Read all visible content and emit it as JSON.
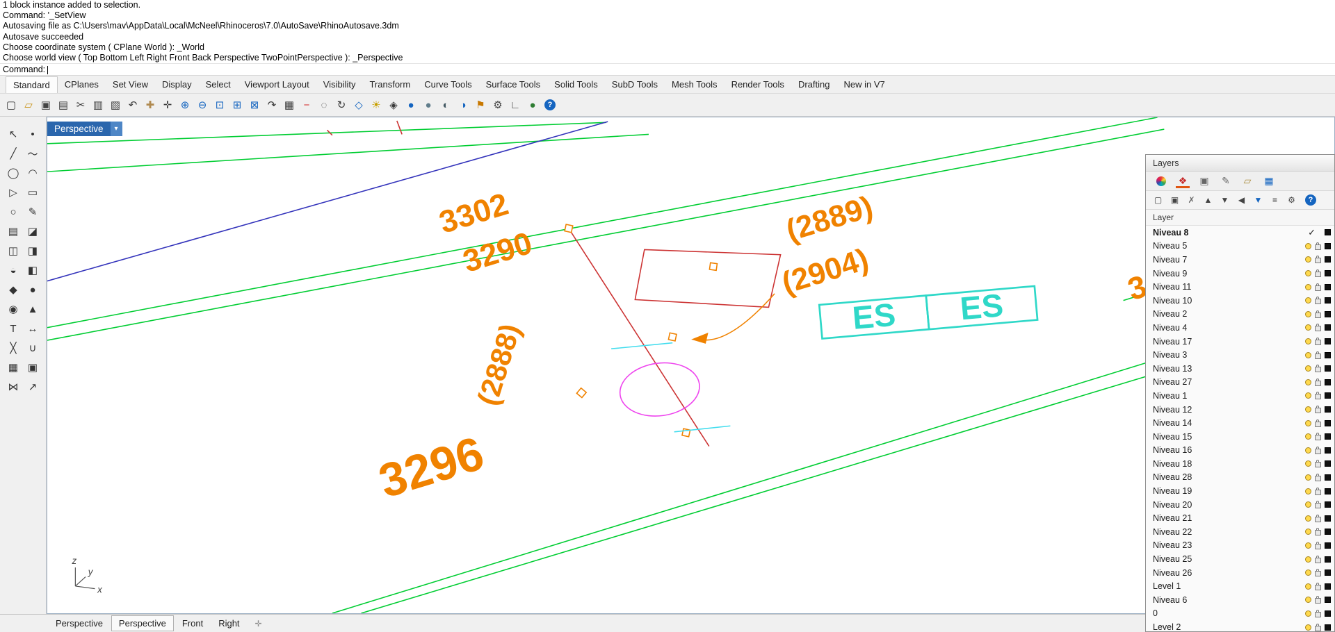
{
  "command_area": {
    "history": [
      "1 block instance added to selection.",
      "Command: '_SetView",
      "Autosaving file as C:\\Users\\mav\\AppData\\Local\\McNeel\\Rhinoceros\\7.0\\AutoSave\\RhinoAutosave.3dm",
      "Autosave succeeded",
      "Choose coordinate system ( CPlane  World ): _World",
      "Choose world view ( Top  Bottom  Left  Right  Front  Back  Perspective  TwoPointPerspective ): _Perspective"
    ],
    "prompt": "Command:"
  },
  "menu_tabs": [
    "Standard",
    "CPlanes",
    "Set View",
    "Display",
    "Select",
    "Viewport Layout",
    "Visibility",
    "Transform",
    "Curve Tools",
    "Surface Tools",
    "Solid Tools",
    "SubD Tools",
    "Mesh Tools",
    "Render Tools",
    "Drafting",
    "New in V7"
  ],
  "toolbar_icons": [
    {
      "n": "new-file-icon",
      "g": "▢"
    },
    {
      "n": "open-file-icon",
      "g": "▱",
      "c": "#c89010"
    },
    {
      "n": "save-icon",
      "g": "▣",
      "c": "#444"
    },
    {
      "n": "print-icon",
      "g": "▤"
    },
    {
      "n": "cut-icon",
      "g": "✂"
    },
    {
      "n": "copy-icon",
      "g": "▥"
    },
    {
      "n": "paste-icon",
      "g": "▧"
    },
    {
      "n": "undo-icon",
      "g": "↶"
    },
    {
      "n": "pan-icon",
      "g": "✚",
      "c": "#b08a50"
    },
    {
      "n": "move-icon",
      "g": "✛"
    },
    {
      "n": "zoom-in-icon",
      "g": "⊕",
      "c": "#1565c0"
    },
    {
      "n": "zoom-out-icon",
      "g": "⊖",
      "c": "#1565c0"
    },
    {
      "n": "zoom-window-icon",
      "g": "⊡",
      "c": "#1565c0"
    },
    {
      "n": "zoom-extents-icon",
      "g": "⊞",
      "c": "#1565c0"
    },
    {
      "n": "zoom-selected-icon",
      "g": "⊠",
      "c": "#1565c0"
    },
    {
      "n": "redo-view-icon",
      "g": "↷"
    },
    {
      "n": "grid-icon",
      "g": "▦"
    },
    {
      "n": "delete-icon",
      "g": "−",
      "c": "#d32f2f"
    },
    {
      "n": "hide-icon",
      "g": "◌"
    },
    {
      "n": "rotate-view-icon",
      "g": "↻"
    },
    {
      "n": "set-view-icon",
      "g": "◇",
      "c": "#1565c0"
    },
    {
      "n": "lamp-icon",
      "g": "☀",
      "c": "#c8a000"
    },
    {
      "n": "lock-icon",
      "g": "◈"
    },
    {
      "n": "render-icon",
      "g": "●",
      "c": "#1565c0"
    },
    {
      "n": "shaded-icon",
      "g": "●",
      "c": "#607d8b"
    },
    {
      "n": "ghosted-icon",
      "g": "◐",
      "c": "#455a64"
    },
    {
      "n": "xray-icon",
      "g": "◑",
      "c": "#1565c0"
    },
    {
      "n": "flag-icon",
      "g": "⚑",
      "c": "#c87800"
    },
    {
      "n": "gear-icon",
      "g": "⚙",
      "c": "#444"
    },
    {
      "n": "cplane-icon",
      "g": "∟",
      "c": "#444"
    },
    {
      "n": "earth-icon",
      "g": "●",
      "c": "#2e7d32"
    },
    {
      "n": "help-icon",
      "g": "?",
      "c": "#fff",
      "bg": "#1565c0",
      "round": true
    }
  ],
  "sidebar_icons": [
    {
      "n": "select-arrow-icon",
      "g": "↖"
    },
    {
      "n": "point-icon",
      "g": "•"
    },
    {
      "n": "polyline-icon",
      "g": "╱"
    },
    {
      "n": "freeform-curve-icon",
      "g": "～"
    },
    {
      "n": "circle-icon",
      "g": "◯"
    },
    {
      "n": "arc-icon",
      "g": "◠"
    },
    {
      "n": "polygon-icon",
      "g": "▷"
    },
    {
      "n": "rectangle-icon",
      "g": "▭"
    },
    {
      "n": "ellipse-icon",
      "g": "○"
    },
    {
      "n": "curve-edit-icon",
      "g": "✎"
    },
    {
      "n": "surface-icon",
      "g": "▤"
    },
    {
      "n": "sweep-icon",
      "g": "◪"
    },
    {
      "n": "extrude-icon",
      "g": "◫"
    },
    {
      "n": "loft-icon",
      "g": "◨"
    },
    {
      "n": "revolve-icon",
      "g": "◒"
    },
    {
      "n": "patch-icon",
      "g": "◧"
    },
    {
      "n": "box-icon",
      "g": "◆"
    },
    {
      "n": "sphere-icon",
      "g": "●"
    },
    {
      "n": "cylinder-icon",
      "g": "◉"
    },
    {
      "n": "cone-icon",
      "g": "▲"
    },
    {
      "n": "text-icon",
      "g": "T"
    },
    {
      "n": "dimension-icon",
      "g": "↔"
    },
    {
      "n": "trim-icon",
      "g": "╳"
    },
    {
      "n": "join-icon",
      "g": "∪"
    },
    {
      "n": "array-icon",
      "g": "▦"
    },
    {
      "n": "block-icon",
      "g": "▣"
    },
    {
      "n": "mirror-icon",
      "g": "⋈"
    },
    {
      "n": "scale-icon",
      "g": "↗"
    }
  ],
  "viewport": {
    "title": "Perspective",
    "dropdown_glyph": "▾",
    "annotations": {
      "a3302": "3302",
      "a3290": "3290",
      "a2889": "(2889)",
      "a2904": "(2904)",
      "a2888": "(2888)",
      "a3296": "3296",
      "partial_right": "3"
    },
    "es_left": "ES",
    "es_right": "ES",
    "axis": {
      "x": "x",
      "y": "y",
      "z": "z"
    },
    "colors": {
      "green": "#00cd32",
      "blue": "#3333bb",
      "red": "#cc3333",
      "magenta": "#ee44ee",
      "cyan": "#44ddee",
      "teal": "#2fd8c8",
      "orange": "#f08200"
    }
  },
  "layers_panel": {
    "title": "Layers",
    "column_header": "Layer",
    "tabs": [
      {
        "n": "properties-tab-icon",
        "type": "ball"
      },
      {
        "n": "layers-tab-icon",
        "g": "❖",
        "c": "#c62828",
        "active": true
      },
      {
        "n": "display-tab-icon",
        "g": "▣",
        "c": "#666"
      },
      {
        "n": "material-tab-icon",
        "g": "✎",
        "c": "#666"
      },
      {
        "n": "folder-tab-icon",
        "g": "▱",
        "c": "#a98a3a"
      },
      {
        "n": "web-tab-icon",
        "g": "▦",
        "c": "#1565c0"
      }
    ],
    "toolbar": [
      {
        "n": "new-layer-icon",
        "g": "▢"
      },
      {
        "n": "new-sublayer-icon",
        "g": "▣"
      },
      {
        "n": "delete-layer-icon",
        "g": "✗",
        "c": "#666"
      },
      {
        "n": "move-up-icon",
        "g": "▲"
      },
      {
        "n": "move-down-icon",
        "g": "▼"
      },
      {
        "n": "expand-icon",
        "g": "◀"
      },
      {
        "n": "filter-icon",
        "g": "▼",
        "c": "#1565c0"
      },
      {
        "n": "sort-icon",
        "g": "≡"
      },
      {
        "n": "tools-icon",
        "g": "⚙"
      },
      {
        "n": "panel-help-icon",
        "g": "?",
        "c": "#fff",
        "bg": "#1565c0",
        "round": true
      }
    ],
    "icons": {
      "current_check": "✓"
    },
    "layers": [
      {
        "name": "Niveau 8",
        "current": true
      },
      {
        "name": "Niveau 5"
      },
      {
        "name": "Niveau 7"
      },
      {
        "name": "Niveau 9"
      },
      {
        "name": "Niveau 11"
      },
      {
        "name": "Niveau 10"
      },
      {
        "name": "Niveau 2"
      },
      {
        "name": "Niveau 4"
      },
      {
        "name": "Niveau 17"
      },
      {
        "name": "Niveau 3"
      },
      {
        "name": "Niveau 13"
      },
      {
        "name": "Niveau 27"
      },
      {
        "name": "Niveau 1"
      },
      {
        "name": "Niveau 12"
      },
      {
        "name": "Niveau 14"
      },
      {
        "name": "Niveau 15"
      },
      {
        "name": "Niveau 16"
      },
      {
        "name": "Niveau 18"
      },
      {
        "name": "Niveau 28"
      },
      {
        "name": "Niveau 19"
      },
      {
        "name": "Niveau 20"
      },
      {
        "name": "Niveau 21"
      },
      {
        "name": "Niveau 22"
      },
      {
        "name": "Niveau 23"
      },
      {
        "name": "Niveau 25"
      },
      {
        "name": "Niveau 26"
      },
      {
        "name": "Level 1"
      },
      {
        "name": "Niveau 6"
      },
      {
        "name": "0"
      },
      {
        "name": "Level 2"
      }
    ]
  },
  "viewport_tabs": {
    "items": [
      "Perspective",
      "Perspective",
      "Front",
      "Right"
    ],
    "active_index": 1,
    "grip_glyph": "✛"
  }
}
